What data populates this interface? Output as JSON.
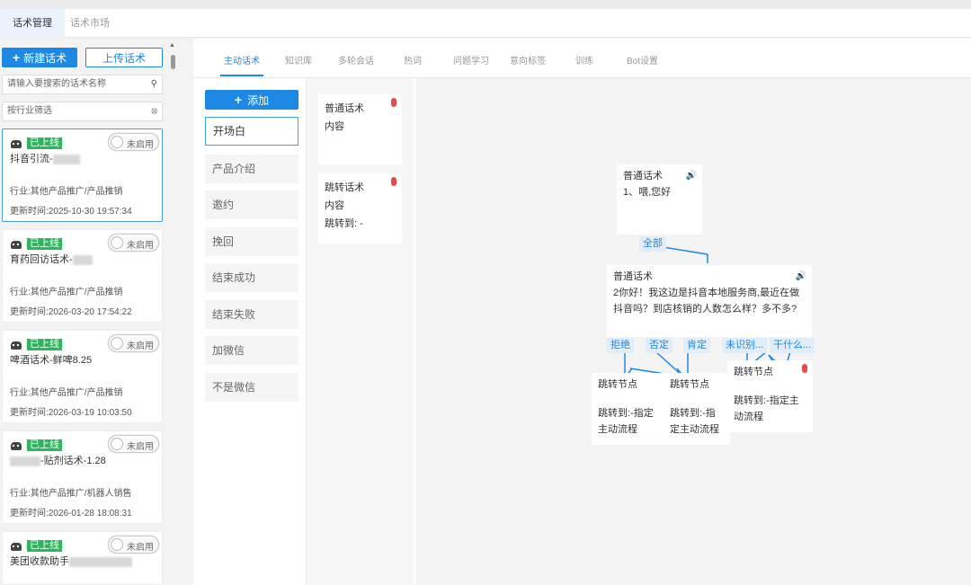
{
  "tabs": [
    {
      "label": "话术管理"
    },
    {
      "label": "话术市场"
    }
  ],
  "left": {
    "new_btn": "新建话术",
    "upload_btn": "上传话术",
    "search_placeholder": "请输入要搜索的话术名称",
    "industry_placeholder": "按行业筛选",
    "cards": [
      {
        "status": "已上线",
        "toggle": "未启用",
        "name": "抖音引流-",
        "industry": "行业:其他产品推广/产品推销",
        "time": "更新时间:2025-10-30 19:57:34"
      },
      {
        "status": "已上线",
        "toggle": "未启用",
        "name": "育药回访话术-",
        "industry": "行业:其他产品推广/产品推销",
        "time": "更新时间:2026-03-20 17:54:22"
      },
      {
        "status": "已上线",
        "toggle": "未启用",
        "name": "啤酒话术-鲜啤8.25",
        "industry": "行业:其他产品推广/产品推销",
        "time": "更新时间:2026-03-19 10:03:50"
      },
      {
        "status": "已上线",
        "toggle": "未启用",
        "name": "-贴剂话术-1.28",
        "industry": "行业:其他产品推广/机器人销售",
        "time": "更新时间:2026-01-28 18:08:31"
      },
      {
        "status": "已上线",
        "toggle": "未启用",
        "name": "美团收款助手",
        "industry": "",
        "time": ""
      }
    ]
  },
  "subtabs": [
    "主动话术",
    "知识库",
    "多轮会话",
    "热词",
    "问题学习",
    "意向标签",
    "训练",
    "Bot设置"
  ],
  "categories": {
    "add_btn": "添加",
    "items": [
      "开场白",
      "产品介绍",
      "邀约",
      "挽回",
      "结束成功",
      "结束失败",
      "加微信",
      "不是微信"
    ]
  },
  "script_cards": [
    {
      "title": "普通话术",
      "content": "内容",
      "jump": ""
    },
    {
      "title": "跳转话术",
      "content": "内容",
      "jump": "跳转到: -"
    }
  ],
  "flow": {
    "node1": {
      "title": "普通话术",
      "text": "1、喂,您好"
    },
    "branch_all": "全部",
    "node2": {
      "title": "普通话术",
      "text": "2你好！我这边是抖音本地服务商,最近在做抖音吗？到店核销的人数怎么样？多不多?"
    },
    "branches": [
      "拒绝",
      "否定",
      "肯定",
      "未识别...",
      "干什么..."
    ],
    "jump_nodes": [
      {
        "title": "跳转节点",
        "text": "跳转到:-指定主动流程"
      },
      {
        "title": "跳转节点",
        "text": "跳转到:-指定主动流程"
      },
      {
        "title": "跳转节点",
        "text": "跳转到:-指定主动流程"
      }
    ]
  },
  "colors": {
    "primary": "#1e88e5",
    "online": "#2fb55d",
    "mic": "#e84a4a",
    "speaker": "#4caf50"
  }
}
